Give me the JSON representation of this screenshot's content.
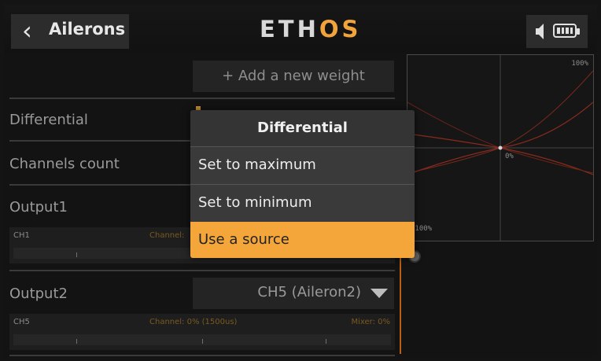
{
  "header": {
    "title": "Ailerons",
    "logo_main": "ETH",
    "logo_accent": "OS",
    "icons": [
      "back-chevron-icon",
      "speaker-icon",
      "battery-icon"
    ]
  },
  "weights": {
    "add_label": "+ Add a new weight"
  },
  "rows": {
    "differential": "Differential",
    "channels_count": "Channels count",
    "output1": "Output1",
    "output2": "Output2"
  },
  "ch1": {
    "name": "CH1",
    "info": "Channel:"
  },
  "ch5": {
    "name": "CH5",
    "info": "Channel: 0% (1500us)",
    "mixer": "Mixer: 0%"
  },
  "output2_select": {
    "value": "CH5 (Aileron2)"
  },
  "curve": {
    "top_label": "100%",
    "center_label": "0%",
    "bottom_label": "-100%"
  },
  "popup": {
    "title": "Differential",
    "options": [
      "Set to maximum",
      "Set to minimum",
      "Use a source"
    ],
    "selected_index": 2
  },
  "colors": {
    "accent": "#f4a63a",
    "curve_line": "#8a2a1e"
  }
}
